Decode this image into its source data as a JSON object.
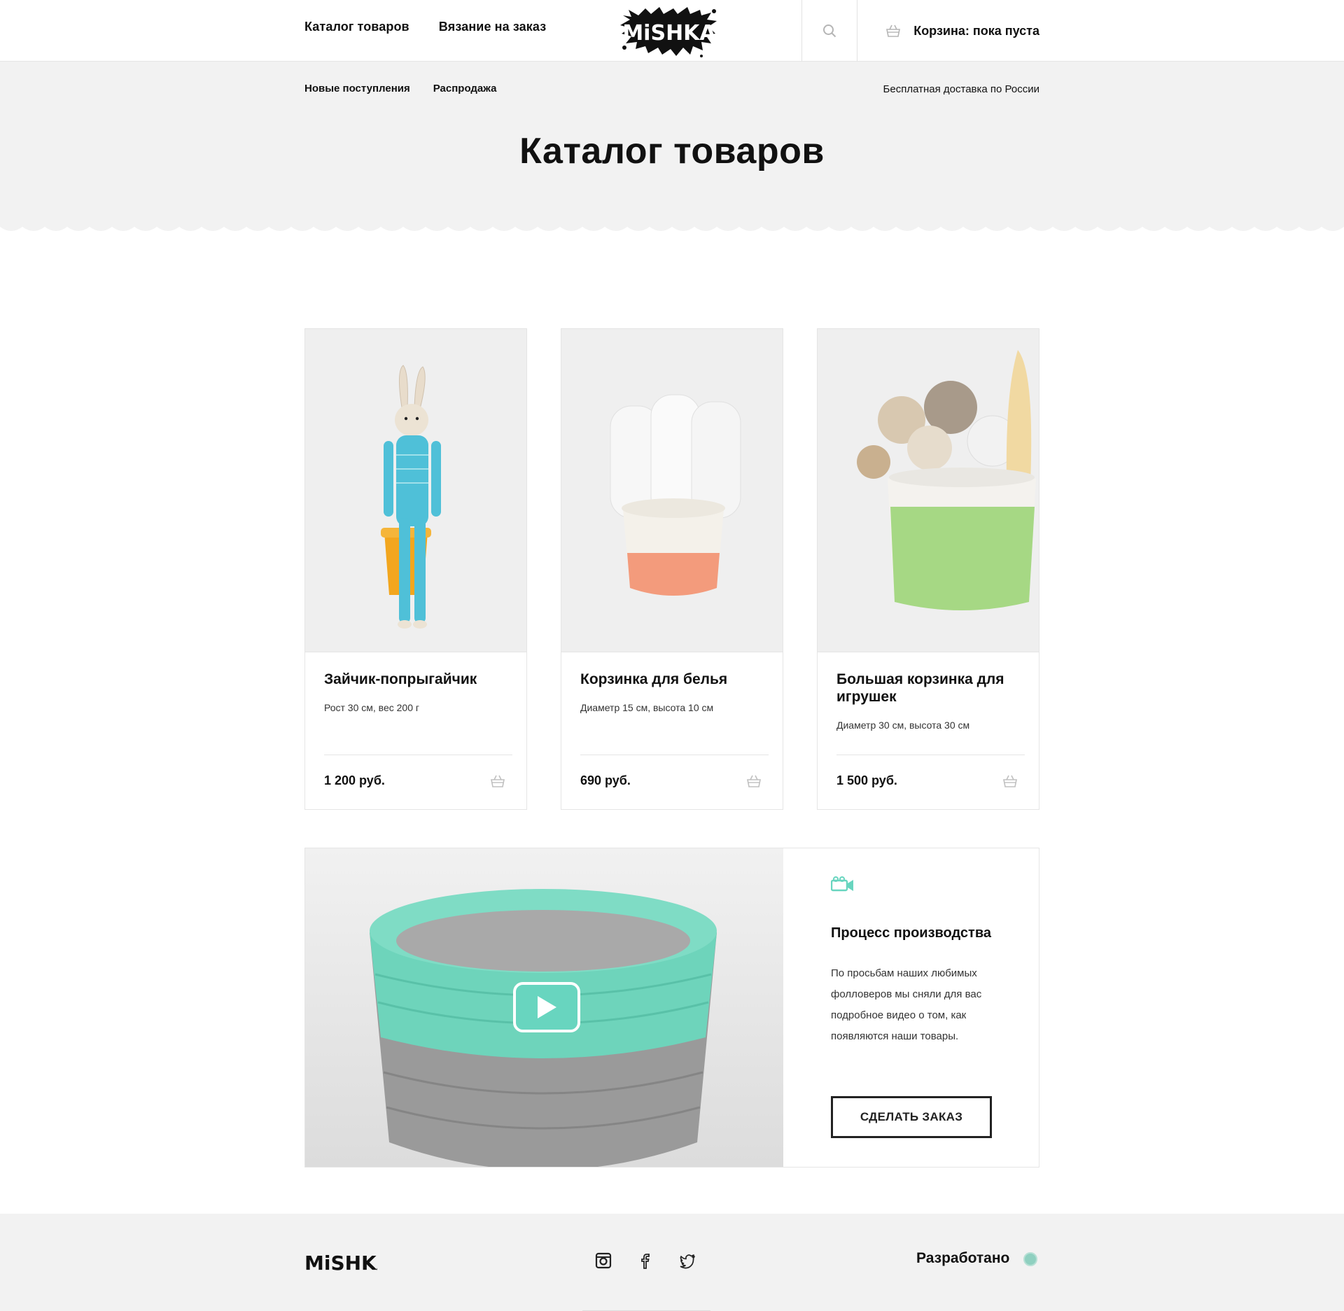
{
  "header": {
    "nav": [
      "Каталог товаров",
      "Вязание на заказ"
    ],
    "logo_text": "MiSHKA",
    "cart_text": "Корзина: пока пуста"
  },
  "subnav": {
    "items": [
      "Новые поступления",
      "Распродажа"
    ],
    "delivery": "Бесплатная доставка по России"
  },
  "page_title": "Каталог товаров",
  "products": [
    {
      "title": "Зайчик-попрыгайчик",
      "desc": "Рост 30 см, вес 200 г",
      "price": "1 200 руб."
    },
    {
      "title": "Корзинка для белья",
      "desc": "Диаметр 15 см, высота 10 см",
      "price": "690 руб."
    },
    {
      "title": "Большая корзинка для игрушек",
      "desc": "Диаметр 30 см, высота 30 см",
      "price": "1 500 руб."
    }
  ],
  "video": {
    "title": "Процесс производства",
    "desc": "По просьбам наших любимых фолловеров мы сняли для вас подробное видео о том, как появляются наши товары.",
    "button": "СДЕЛАТЬ ЗАКАЗ"
  },
  "footer": {
    "logo_text": "MiSHKA",
    "developed": "Разработано"
  },
  "colors": {
    "accent": "#68d5bf",
    "bg_grey": "#f2f2f2",
    "text": "#111111"
  },
  "icons": [
    "search-icon",
    "cart-icon",
    "video-camera-icon",
    "play-icon",
    "instagram-icon",
    "facebook-icon",
    "twitter-icon"
  ]
}
